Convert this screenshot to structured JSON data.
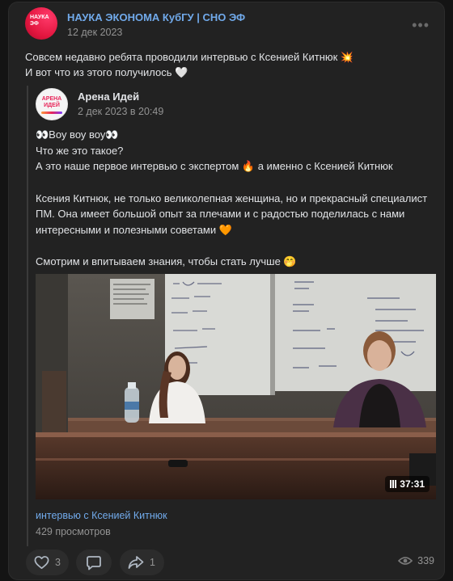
{
  "post": {
    "author": "НАУКА ЭКОНОМА КубГУ | СНО ЭФ",
    "date": "12 дек 2023",
    "avatar_logo": "НАУКА ЭФ",
    "text_line1": "Совсем недавно ребята проводили интервью с Ксенией Китнюк 💥",
    "text_line2": "И вот что из этого получилось 🤍"
  },
  "repost": {
    "author": "Арена Идей",
    "date": "2 дек 2023 в 20:49",
    "avatar_logo": "АРЕНА ИДЕЙ",
    "lines": [
      "👀Воу воу воу👀",
      "Что же это такое?",
      "А это наше первое интервью с экспертом 🔥 а именно с Ксенией Китнюк",
      "Ксения Китнюк, не только великолепная женщина, но и прекрасный специалист",
      "ПМ. Она имеет большой опыт за плечами и с радостью поделилась с нами",
      "интересными и полезными советами 🧡",
      "Смотрим и впитываем знания, чтобы стать лучше 🤭"
    ]
  },
  "video": {
    "duration": "37:31",
    "title": "интервью с Ксенией Китнюк",
    "views": "429 просмотров",
    "board_left": [
      "U = Q₄×Q₈",
      "P₄ = 40",
      "P₈ = 40",
      "Q₈ = 25",
      "..."
    ],
    "board_right": [
      "Q₁ = 90/20",
      "Q₄ = 80/20",
      "MRS = 4/8",
      "MRS = 30/25",
      "Q₈ = 8",
      "эф-т дохода",
      "I = 10,3+25",
      "ΔU =",
      "ΔI = 600-"
    ]
  },
  "actions": {
    "likes": "3",
    "comments": "",
    "shares": "1",
    "views": "339"
  },
  "icons": {
    "more": "more-dots-icon",
    "like": "heart-icon",
    "comment": "comment-icon",
    "share": "share-icon",
    "views": "eye-icon"
  },
  "colors": {
    "link": "#71aaeb",
    "card": "#222222",
    "accent_red": "#e3163f"
  }
}
